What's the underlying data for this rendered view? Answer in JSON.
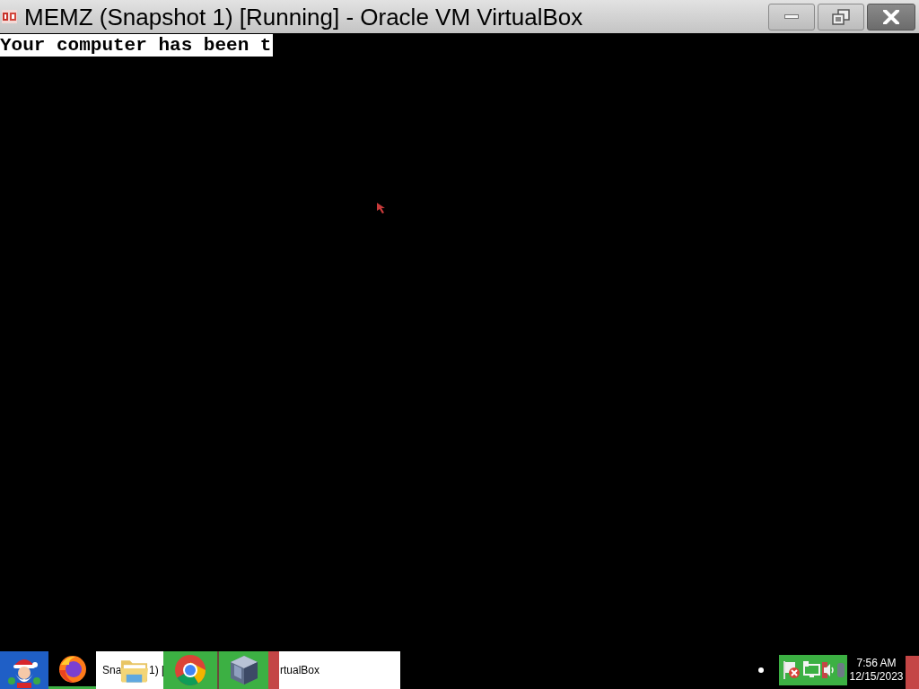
{
  "window": {
    "title": "MEMZ (Snapshot 1) [Running] - Oracle VM VirtualBox"
  },
  "screen": {
    "text": "Your computer has been t"
  },
  "taskbar": {
    "window_button": {
      "text_pieces": [
        "Sna",
        "1) [",
        "rtualBox"
      ]
    }
  },
  "clock": {
    "time": "7:56 AM",
    "date": "12/15/2023"
  }
}
